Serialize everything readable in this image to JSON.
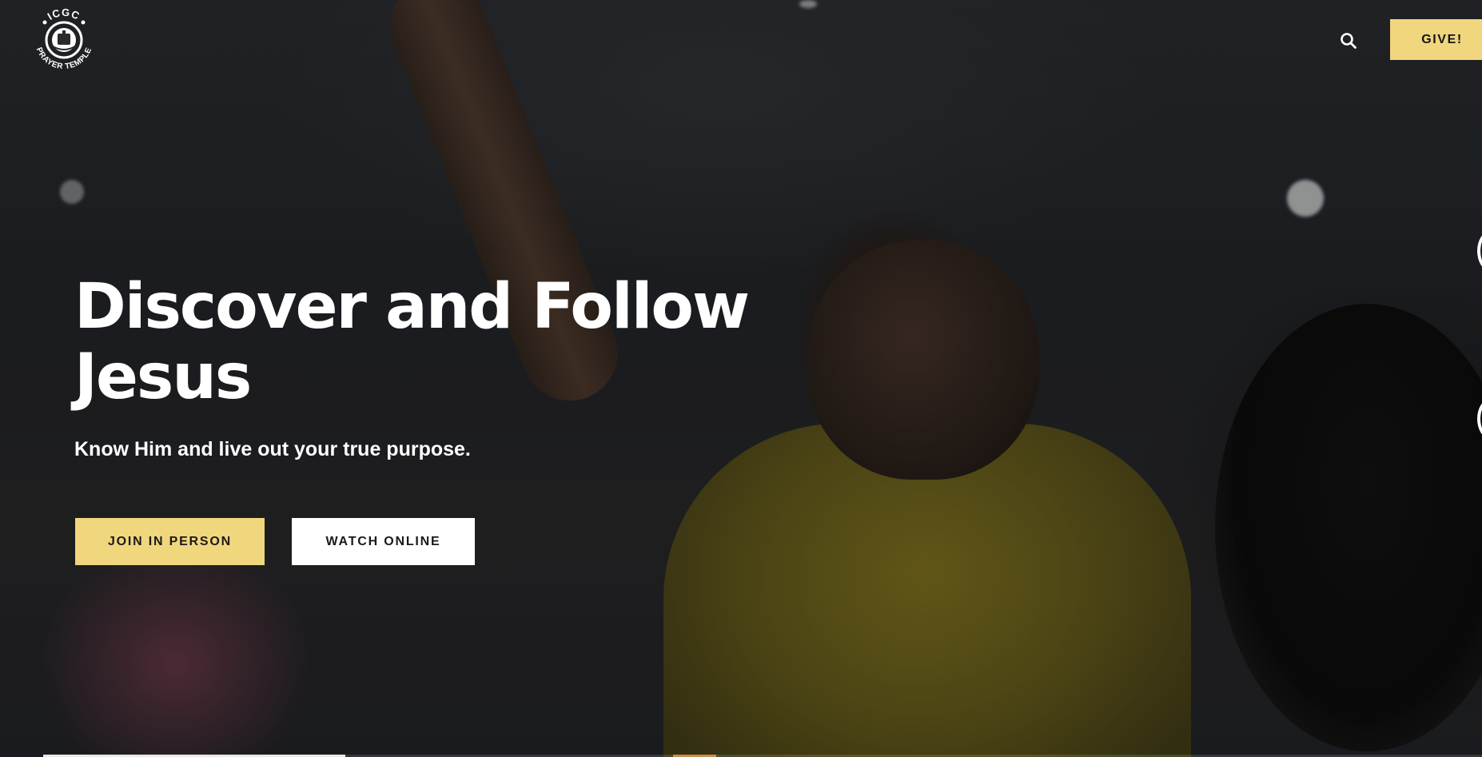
{
  "header": {
    "logo_alt": "ICGC Prayer Temple",
    "logo_text_top": "ICGC",
    "logo_text_bottom": "PRAYER TEMPLE",
    "search_icon": "search-icon",
    "give_label": "GIVE!"
  },
  "hero": {
    "headline": "Discover and Follow Jesus",
    "subheadline": "Know Him and live out your true purpose.",
    "primary_cta": "JOIN IN PERSON",
    "secondary_cta": "WATCH ONLINE"
  },
  "colors": {
    "accent": "#f0d67d",
    "text_on_dark": "#ffffff",
    "button_text": "#1a1a1a"
  },
  "slider": {
    "progress_fraction": 0.21
  }
}
